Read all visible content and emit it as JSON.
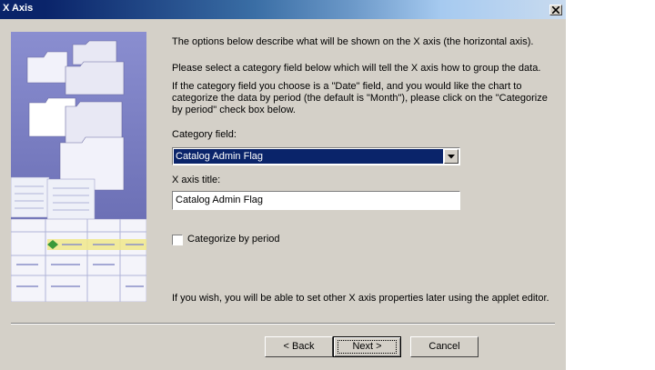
{
  "window": {
    "title": "X Axis"
  },
  "content": {
    "intro": "The options below describe what will be shown on the X axis (the horizontal axis).",
    "instruction": "Please select a category field below which will tell the X axis how to group the data.",
    "date_note_lines": [
      "If the category field you choose is a \"Date\" field, and you would like the chart to",
      "categorize the data by period (the default is \"Month\"), please click on the \"Categorize",
      "by period\" check box below."
    ],
    "category_field_label": "Category field:",
    "category_field_value": "Catalog Admin Flag",
    "x_axis_title_label": "X axis title:",
    "x_axis_title_value": "Catalog Admin Flag",
    "categorize_label": "Categorize by period",
    "categorize_checked": false,
    "footer_note": "If you wish, you will be able to set other X axis properties later using the applet editor."
  },
  "buttons": {
    "back": "< Back",
    "next": "Next >",
    "cancel": "Cancel"
  }
}
